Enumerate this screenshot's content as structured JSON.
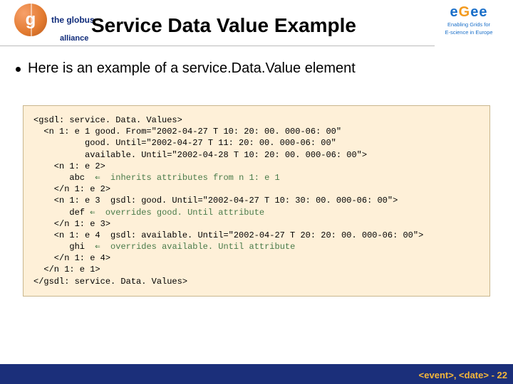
{
  "logos": {
    "globus_g": "g",
    "globus_top": "the globus",
    "globus_bottom": "alliance",
    "egee_letters": "eGee",
    "egee_sub1": "Enabling Grids for",
    "egee_sub2": "E-science in Europe"
  },
  "title": "Service Data Value Example",
  "bullet": "Here is an example of a service.Data.Value element",
  "code": {
    "l01": "<gsdl: service. Data. Values>",
    "l02": "  <n 1: e 1 good. From=\"2002-04-27 T 10: 20: 00. 000-06: 00\"",
    "l03": "          good. Until=\"2002-04-27 T 11: 20: 00. 000-06: 00\"",
    "l04": "          available. Until=\"2002-04-28 T 10: 20: 00. 000-06: 00\">",
    "l05": "    <n 1: e 2>",
    "l06a": "       abc  ",
    "l06arrow": "⇐",
    "l06b": "  inherits attributes from n 1: e 1",
    "l07": "    </n 1: e 2>",
    "l08": "    <n 1: e 3  gsdl: good. Until=\"2002-04-27 T 10: 30: 00. 000-06: 00\">",
    "l09a": "       def ",
    "l09arrow": "⇐",
    "l09b": "  overrides good. Until attribute",
    "l10": "    </n 1: e 3>",
    "l11": "    <n 1: e 4  gsdl: available. Until=\"2002-04-27 T 20: 20: 00. 000-06: 00\">",
    "l12a": "       ghi  ",
    "l12arrow": "⇐",
    "l12b": "  overrides available. Until attribute",
    "l13": "    </n 1: e 4>",
    "l14": "  </n 1: e 1>",
    "l15": "</gsdl: service. Data. Values>"
  },
  "footer": {
    "event": "<event>",
    "date": "<date>",
    "sep": ", ",
    "dash": "  - ",
    "page": "22"
  }
}
